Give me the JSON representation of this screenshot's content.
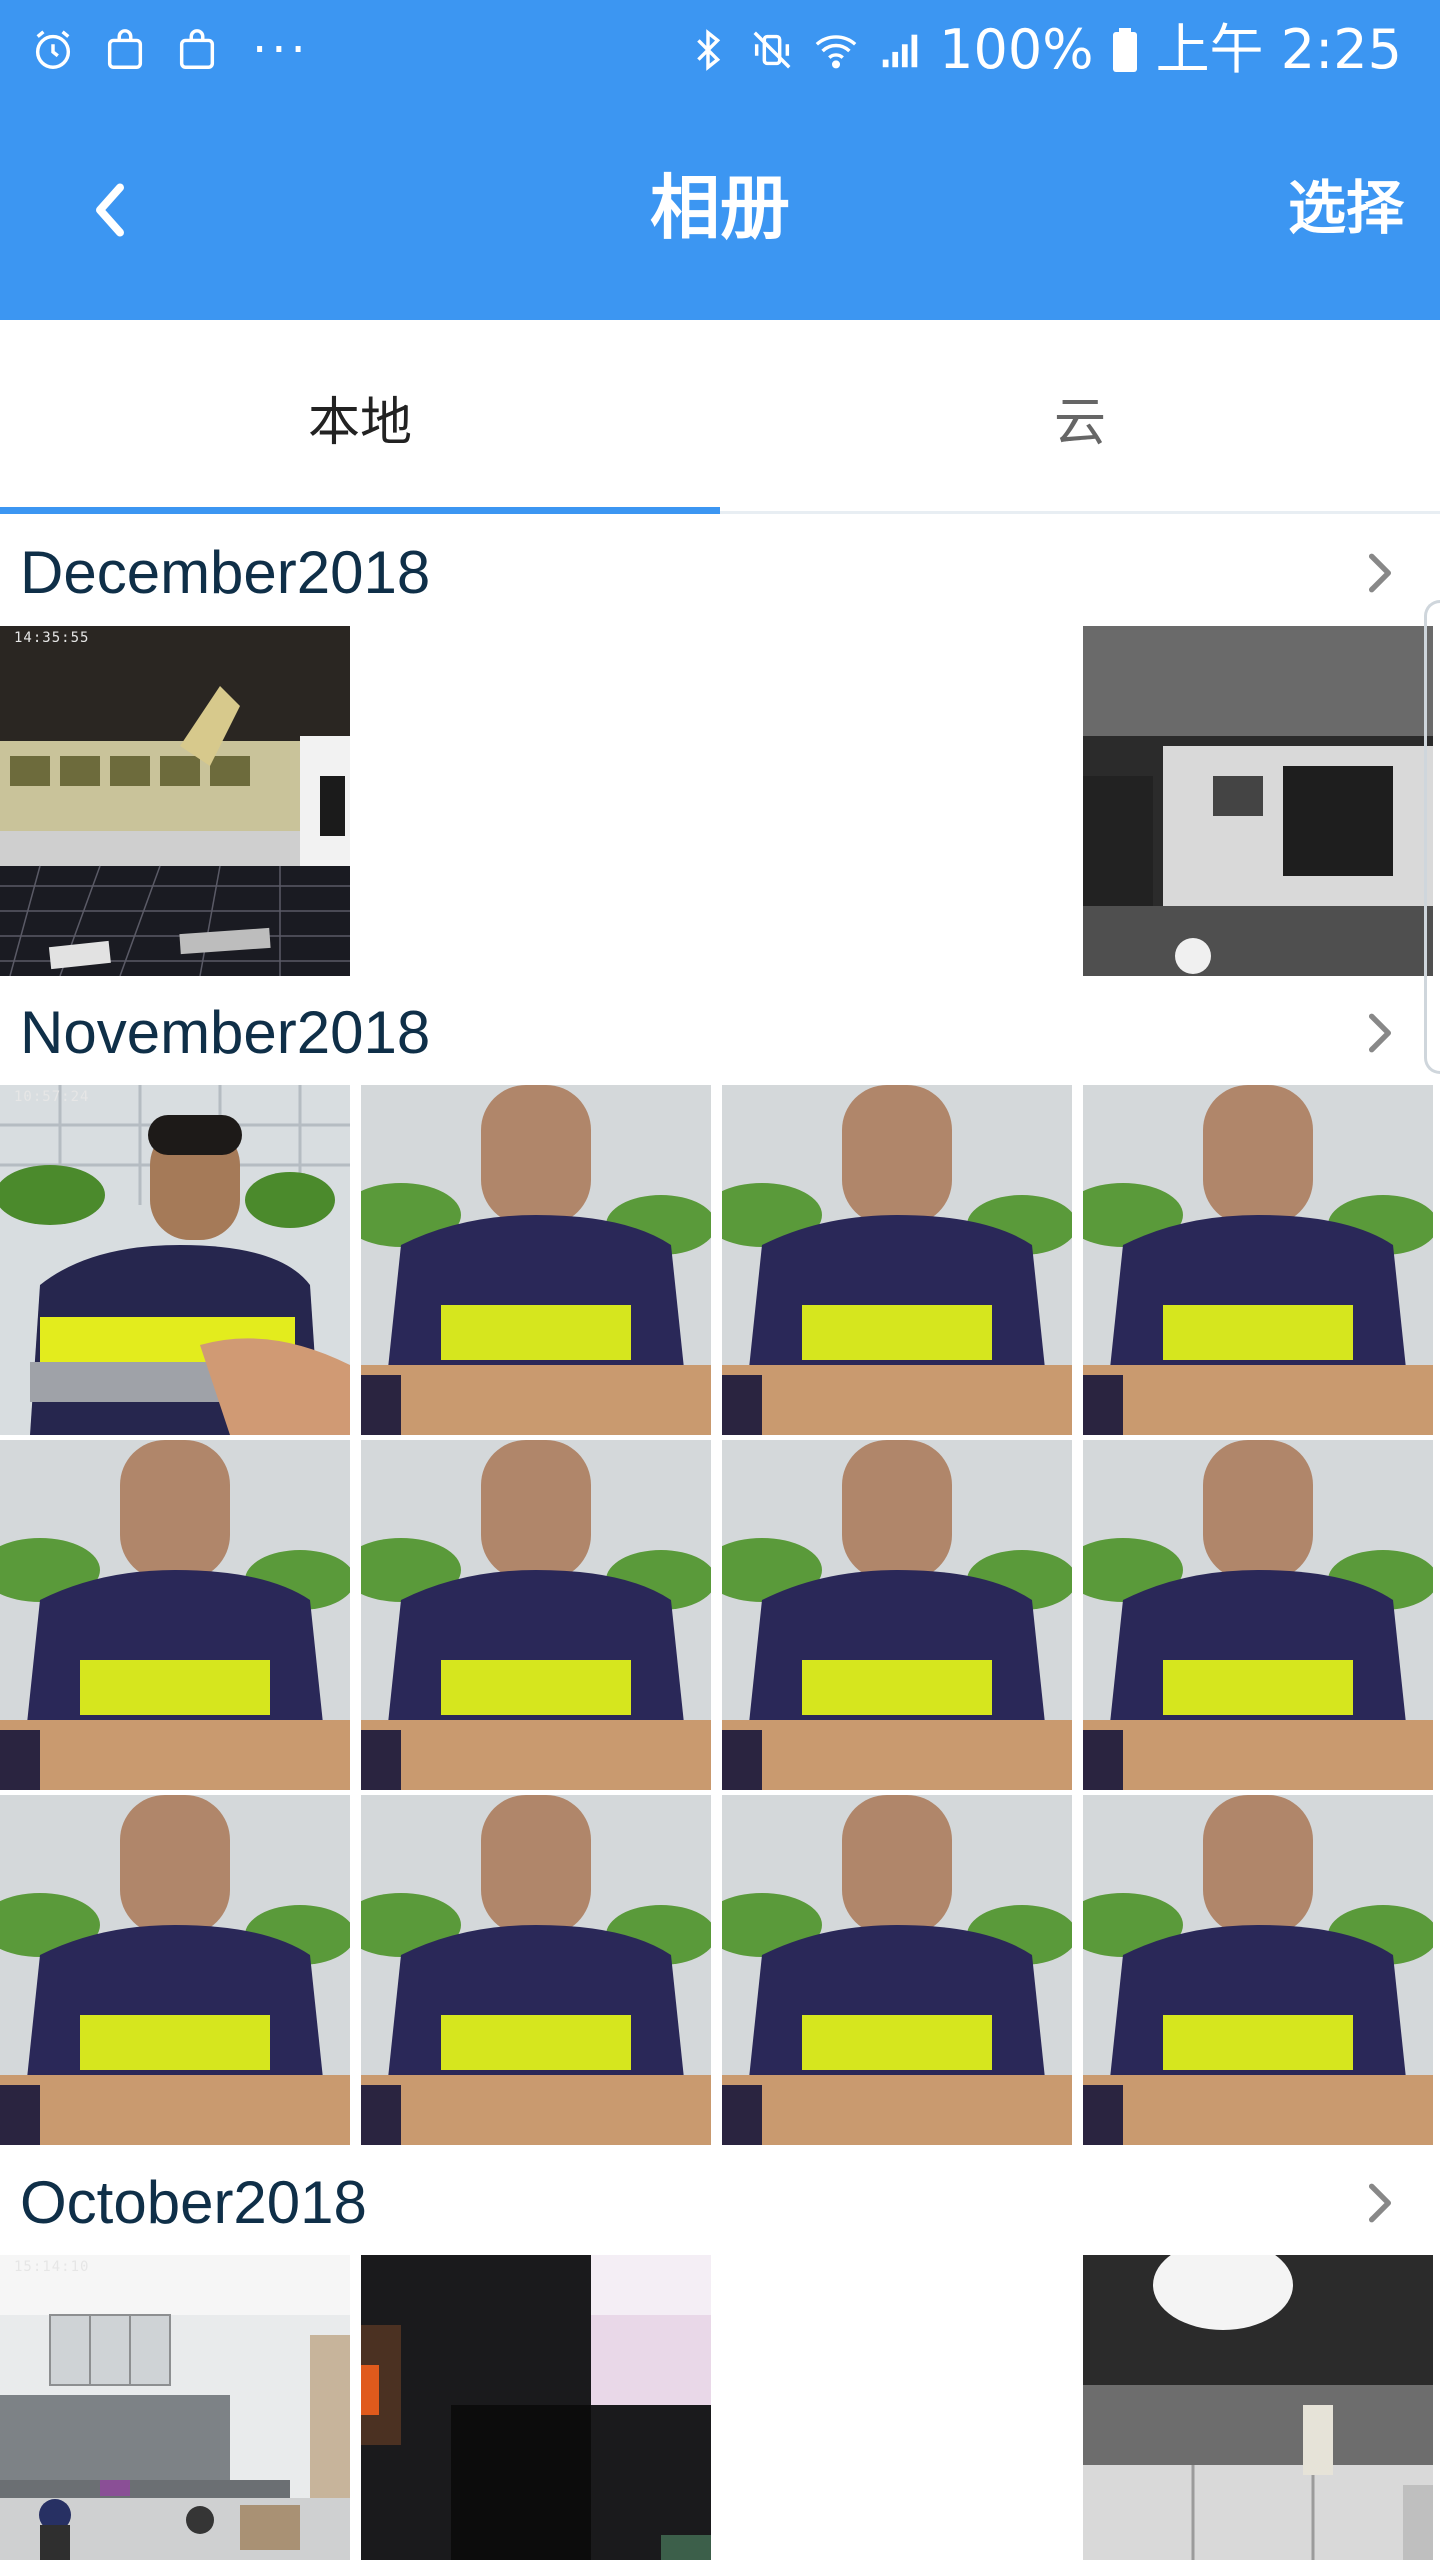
{
  "status_bar": {
    "left_icons": [
      "alarm-icon",
      "bag-notification-icon",
      "bag-notification-icon",
      "more-dots-icon"
    ],
    "more": "···",
    "right_icons": [
      "bluetooth-icon",
      "vibrate-off-icon",
      "wifi-icon",
      "signal-icon"
    ],
    "battery_percent": "100%",
    "time": "上午 2:25",
    "text_color": "#ffffff"
  },
  "toolbar": {
    "back_icon": "chevron-left-icon",
    "title": "相册",
    "select_label": "选择",
    "background_color": "#3c96f2"
  },
  "tabs": {
    "items": [
      {
        "label": "本地",
        "active": true
      },
      {
        "label": "云",
        "active": false
      }
    ],
    "indicator_color": "#3c96f2"
  },
  "sections": [
    {
      "title": "December2018",
      "chevron_icon": "chevron-right-icon",
      "photos": [
        {
          "kind": "office-wide",
          "stamp": "14:35:55"
        },
        {
          "kind": "night-grayscale",
          "stamp": ""
        }
      ]
    },
    {
      "title": "November2018",
      "chevron_icon": "chevron-right-icon",
      "photos": [
        {
          "kind": "person-clear",
          "stamp": "10:57:24"
        },
        {
          "kind": "person-blurred",
          "stamp": ""
        },
        {
          "kind": "person-blurred",
          "stamp": ""
        },
        {
          "kind": "person-blurred",
          "stamp": ""
        },
        {
          "kind": "person-blurred",
          "stamp": ""
        },
        {
          "kind": "person-blurred",
          "stamp": ""
        },
        {
          "kind": "person-blurred",
          "stamp": ""
        },
        {
          "kind": "person-blurred",
          "stamp": ""
        },
        {
          "kind": "person-blurred",
          "stamp": ""
        },
        {
          "kind": "person-blurred",
          "stamp": ""
        },
        {
          "kind": "person-blurred",
          "stamp": ""
        },
        {
          "kind": "person-blurred",
          "stamp": ""
        }
      ]
    },
    {
      "title": "October2018",
      "chevron_icon": "chevron-right-icon",
      "photos": [
        {
          "kind": "lab-room",
          "stamp": "15:14:10"
        },
        {
          "kind": "dark-closeup",
          "stamp": ""
        },
        {
          "kind": "gray-room",
          "stamp": ""
        }
      ]
    }
  ]
}
